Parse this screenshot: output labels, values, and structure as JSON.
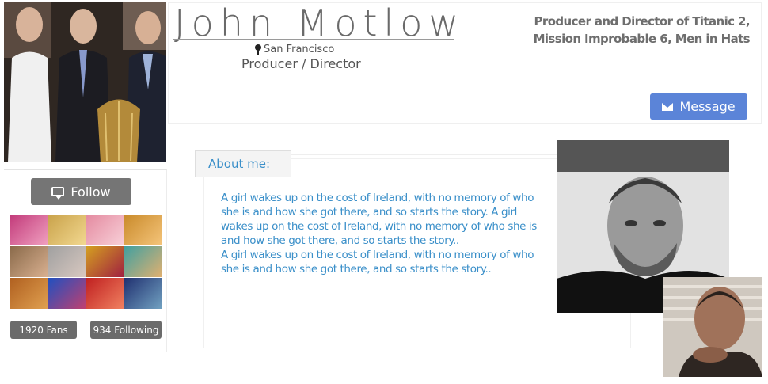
{
  "profile": {
    "name": "John Motlow",
    "location": "San Francisco",
    "role": "Producer / Director",
    "credits": "Producer and Director of Titanic 2, Mission Improbable 6, Men in Hats"
  },
  "actions": {
    "follow_label": "Follow",
    "message_label": "Message"
  },
  "stats": {
    "fans": "1920 Fans",
    "following": "934 Following"
  },
  "about": {
    "heading": "About me:",
    "paragraph_1": "A girl wakes up on the cost of Ireland, with no memory of who she is and how she got there, and so starts the story. A girl wakes up on the cost of Ireland, with no memory of who she is and how she got there, and so starts the story..",
    "paragraph_2": "A girl wakes up on the cost of Ireland, with no memory of who she is and how she got there, and so starts the story.."
  },
  "icons": {
    "follow": "speech-bubble-icon",
    "message": "envelope-icon",
    "location": "map-pin-icon"
  },
  "colors": {
    "accent_blue": "#5b84d8",
    "text_blue": "#3a8fc9",
    "button_gray": "#757575"
  }
}
